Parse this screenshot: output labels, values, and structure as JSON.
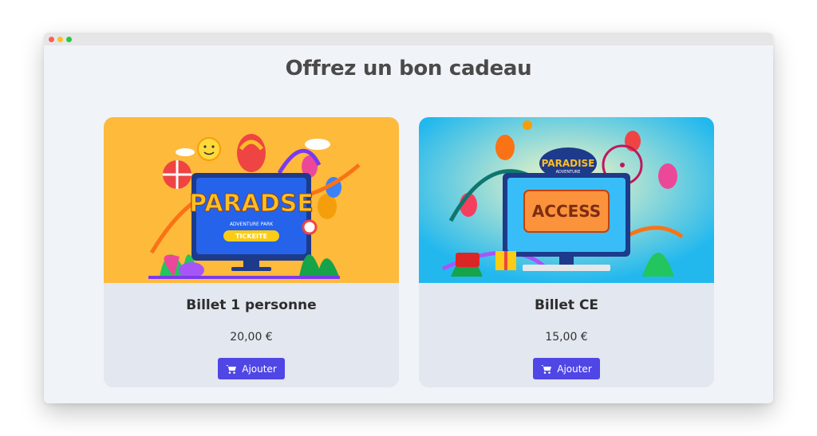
{
  "page": {
    "title": "Offrez un bon cadeau"
  },
  "products": [
    {
      "name": "Billet 1 personne",
      "price": "20,00 €",
      "button_label": "Ajouter",
      "image": {
        "brand": "PARADISE",
        "sub": "ADVENTURE PARK",
        "ticket": "TICKETS",
        "background": "#fdba3b"
      }
    },
    {
      "name": "Billet CE",
      "price": "15,00 €",
      "button_label": "Ajouter",
      "image": {
        "brand": "PARADISE",
        "sub": "ADVENTURE",
        "ticket": "ACCESS",
        "background": "#1fb6e8"
      }
    }
  ],
  "colors": {
    "button": "#4f46e5",
    "card_bg": "#e3e7ef",
    "page_bg": "#f0f3f8"
  },
  "icons": {
    "add_button": "shopping-cart-icon"
  }
}
